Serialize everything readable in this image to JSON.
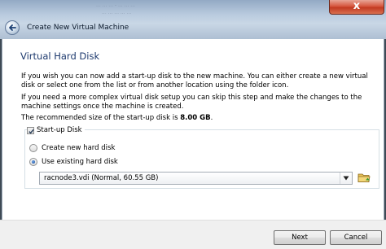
{
  "window": {
    "title": "Create New Virtual Machine",
    "background_text": [
      "... ... ... - ... ... ...",
      "... ... ... ... ..."
    ],
    "close_glyph": "x"
  },
  "page": {
    "heading": "Virtual Hard Disk",
    "paragraph1": "If you wish you can now add a start-up disk to the new machine. You can either create a new virtual disk or select one from the list or from another location using the folder icon.",
    "paragraph2": "If you need a more complex virtual disk setup you can skip this step and make the changes to the machine settings once the machine is created.",
    "recommended_prefix": "The recommended size of the start-up disk is ",
    "recommended_size": "8.00 GB",
    "recommended_suffix": "."
  },
  "startup_disk": {
    "label": "Start-up Disk",
    "checked": true,
    "options": [
      {
        "label": "Create new hard disk",
        "selected": false
      },
      {
        "label": "Use existing hard disk",
        "selected": true
      }
    ],
    "selected_disk": "racnode3.vdi (Normal, 60.55 GB)"
  },
  "buttons": {
    "next": "Next",
    "cancel": "Cancel"
  },
  "icons": {
    "back": "back-arrow-icon",
    "close": "close-icon",
    "dropdown": "chevron-down-icon",
    "folder": "folder-icon"
  },
  "colors": {
    "heading": "#1e3a6e",
    "close_button": "#c23a22"
  }
}
